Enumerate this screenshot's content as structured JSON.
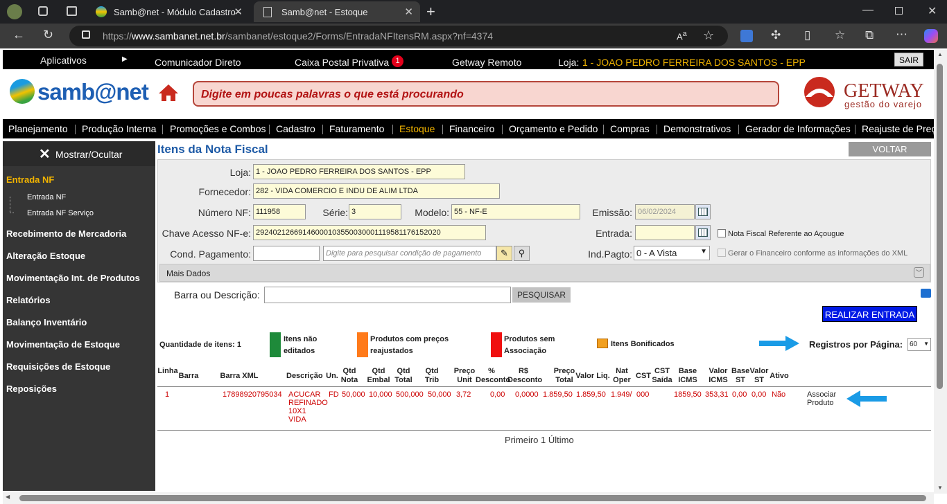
{
  "browser": {
    "tabs": [
      {
        "title": "Samb@net - Módulo Cadastro -"
      },
      {
        "title": "Samb@net - Estoque"
      }
    ],
    "url_prefix": "https://",
    "url_host": "www.sambanet.net.br",
    "url_path": "/sambanet/estoque2/Forms/EntradaNFItensRM.aspx?nf=4374"
  },
  "topbar": {
    "apps": "Aplicativos",
    "comm": "Comunicador Direto",
    "mail": "Caixa Postal Privativa",
    "mail_count": "1",
    "remote": "Getway Remoto",
    "store_label": "Loja:",
    "store_value": "1 - JOAO PEDRO FERREIRA DOS SANTOS - EPP",
    "logout": "SAIR"
  },
  "header": {
    "logo": "samb@net",
    "search_placeholder": "Digite em poucas palavras o que está procurando",
    "brand": "GETWAY",
    "brand_sub": "gestão do varejo"
  },
  "menu": [
    "Planejamento",
    "Produção Interna",
    "Promoções e Combos",
    "Cadastro",
    "Faturamento",
    "Estoque",
    "Financeiro",
    "Orçamento e Pedido",
    "Compras",
    "Demonstrativos",
    "Gerador de Informações",
    "Reajuste de Preço"
  ],
  "sidebar": {
    "toggle": "Mostrar/Ocultar",
    "section": "Entrada NF",
    "sub": [
      "Entrada NF",
      "Entrada NF Serviço"
    ],
    "items": [
      "Recebimento de Mercadoria",
      "Alteração Estoque",
      "Movimentação Int. de Produtos",
      "Relatórios",
      "Balanço Inventário",
      "Movimentação de Estoque",
      "Requisições de Estoque",
      "Reposições"
    ]
  },
  "form": {
    "title": "Itens da Nota Fiscal",
    "back": "VOLTAR",
    "loja_label": "Loja:",
    "loja": "1 - JOAO PEDRO FERREIRA DOS SANTOS - EPP",
    "forn_label": "Fornecedor:",
    "forn": "282 - VIDA COMERCIO E INDU DE ALIM LTDA",
    "num_label": "Número NF:",
    "num": "111958",
    "serie_label": "Série:",
    "serie": "3",
    "modelo_label": "Modelo:",
    "modelo": "55 - NF-E",
    "emissao_label": "Emissão:",
    "emissao": "06/02/2024",
    "chave_label": "Chave Acesso NF-e:",
    "chave": "29240212669146000103550030001119581176152020",
    "entrada_label": "Entrada:",
    "acougue": "Nota Fiscal Referente ao Açougue",
    "cond_label": "Cond. Pagamento:",
    "cond_placeholder": "Digite para pesquisar condição de pagamento",
    "indpag_label": "Ind.Pagto:",
    "indpag": "0 - A Vista",
    "financeiro": "Gerar o Financeiro conforme as informações do XML",
    "mais": "Mais Dados"
  },
  "search": {
    "label": "Barra ou Descrição:",
    "button": "PESQUISAR"
  },
  "realizar": "REALIZAR ENTRADA",
  "legend": {
    "qty": "Quantidade de itens: 1",
    "a": "Itens não editados",
    "b": "Produtos com preços reajustados",
    "c": "Produtos sem Associação",
    "d": "Itens Bonificados",
    "colors": {
      "a": "#1e8a3a",
      "b": "#ff7a1a",
      "c": "#f01010"
    }
  },
  "per_page_label": "Registros por Página:",
  "per_page": "60",
  "table": {
    "headers": [
      "Linha",
      "Barra",
      "Barra XML",
      "Descrição",
      "Un.",
      "Qtd Nota",
      "Qtd Embal",
      "Qtd Total",
      "Qtd Trib",
      "Preço Unit",
      "% Desconto",
      "R$ Desconto",
      "Preço Total",
      "Valor Liq.",
      "Nat Oper",
      "CST",
      "CST Saída",
      "Base ICMS",
      "Valor ICMS",
      "Base ST",
      "Valor ST",
      "Ativo"
    ],
    "row": {
      "linha": "1",
      "barra_xml": "17898920795034",
      "desc": "ACUCAR REFINADO 10X1 VIDA",
      "un": "FD",
      "qtd_nota": "50,000",
      "qtd_embal": "10,000",
      "qtd_total": "500,000",
      "qtd_trib": "50,000",
      "preco_unit": "3,72",
      "pct": "0,00",
      "rs": "0,0000",
      "preco_total": "1.859,50",
      "valor_liq": "1.859,50",
      "nat": "1.949/",
      "cst": "000",
      "base_icms": "1859,50",
      "valor_icms": "353,31",
      "base_st": "0,00",
      "valor_st": "0,00",
      "ativo": "Não",
      "acao": "Associar Produto"
    }
  },
  "pager": "Primeiro 1 Último"
}
